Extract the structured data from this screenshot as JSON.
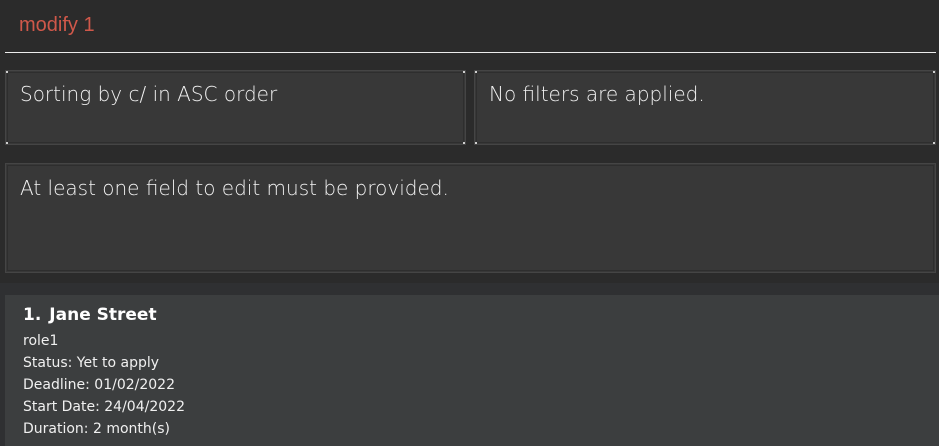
{
  "command": {
    "value": "modify 1",
    "color": "#d0584a"
  },
  "sort_panel": {
    "text": "Sorting by c/ in ASC order"
  },
  "filter_panel": {
    "text": "No filters are applied."
  },
  "result_panel": {
    "text": "At least one field to edit must be provided."
  },
  "applications": [
    {
      "index": "1.",
      "company": "Jane Street",
      "role": "role1",
      "status": "Status: Yet to apply",
      "deadline": "Deadline: 01/02/2022",
      "start_date": "Start Date: 24/04/2022",
      "duration": "Duration: 2 month(s)"
    }
  ]
}
